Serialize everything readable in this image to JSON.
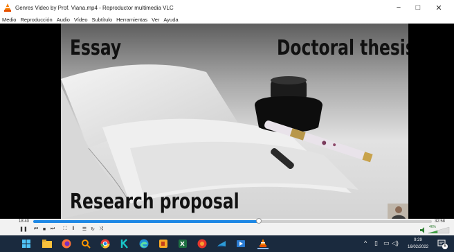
{
  "window": {
    "title": "Genres Video by Prof. Viana.mp4 - Reproductor multimedia VLC",
    "minimize_glyph": "−",
    "maximize_glyph": "□",
    "close_glyph": "✕"
  },
  "menu": [
    "Medio",
    "Reproducción",
    "Audio",
    "Vídeo",
    "Subtítulo",
    "Herramientas",
    "Ver",
    "Ayuda"
  ],
  "video": {
    "captions": {
      "essay": "Essay",
      "thesis": "Doctoral thesis",
      "research": "Research proposal"
    }
  },
  "playback": {
    "current_time": "18:40",
    "total_time": "32:58",
    "progress_fraction": 0.566,
    "volume_label": "46%",
    "accent_color": "#1e88e5"
  },
  "controls": {
    "pause_glyph": "❚❚",
    "prev_glyph": "⏮",
    "stop_glyph": "■",
    "next_glyph": "⏭",
    "fullscreen_glyph": "⛶",
    "ext_settings_glyph": "⫴",
    "playlist_glyph": "☰",
    "loop_glyph": "↻",
    "shuffle_glyph": "⤨"
  },
  "taskbar": {
    "time": "9:29",
    "date": "16/02/2022",
    "notification_count": "6",
    "tray_chevron": "^",
    "icons": [
      "windows-start-icon",
      "file-explorer-icon",
      "firefox-icon",
      "search-icon",
      "chrome-icon",
      "k-app-icon",
      "edge-icon",
      "powerpoint-icon",
      "excel-icon",
      "word-icon",
      "teams-icon",
      "vlc-icon"
    ]
  }
}
